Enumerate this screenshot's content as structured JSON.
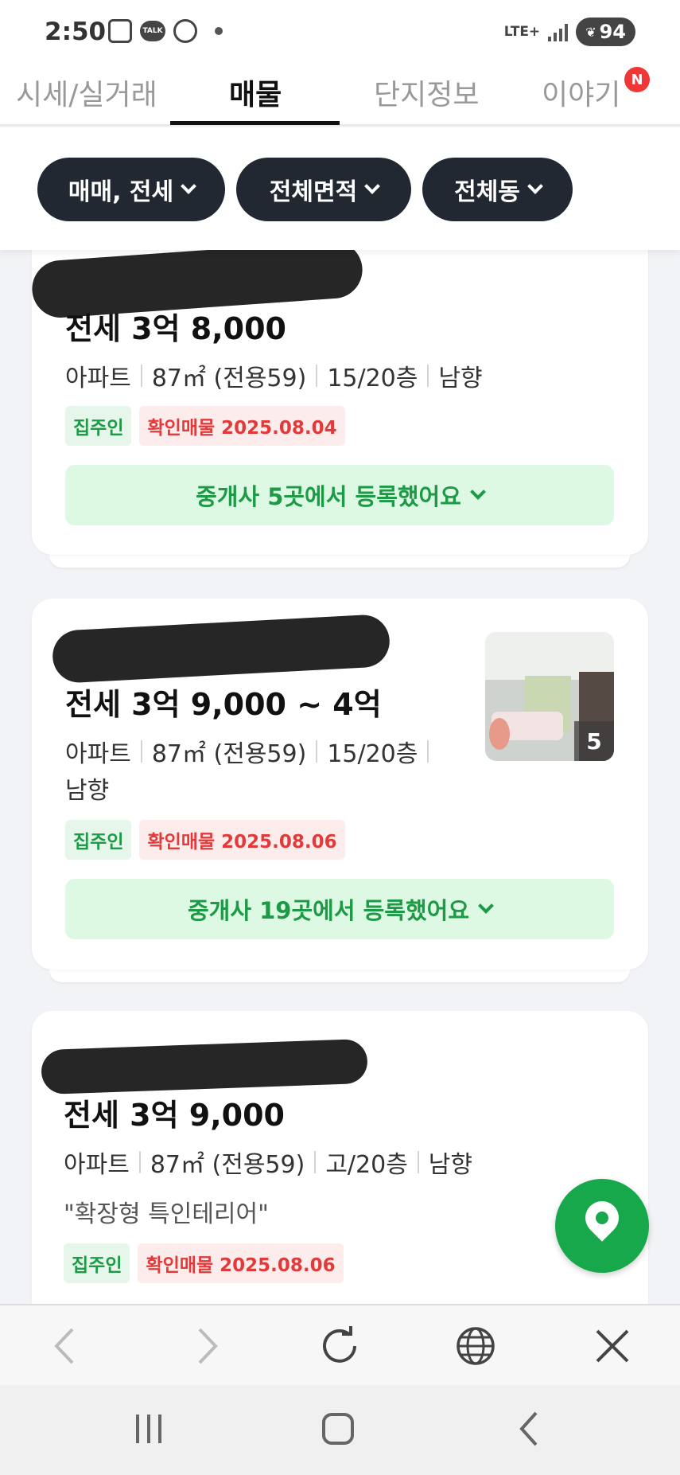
{
  "status_bar": {
    "time": "2:50",
    "talk_label": "TALK",
    "network": "LTE+",
    "battery": "94"
  },
  "tabs": [
    {
      "label": "시세/실거래",
      "active": false
    },
    {
      "label": "매물",
      "active": true
    },
    {
      "label": "단지정보",
      "active": false
    },
    {
      "label": "이야기",
      "active": false,
      "badge": "N"
    }
  ],
  "filters": [
    {
      "label": "매매, 전세"
    },
    {
      "label": "전체면적"
    },
    {
      "label": "전체동"
    }
  ],
  "listings": [
    {
      "price": "전세 3억 8,000",
      "type": "아파트",
      "area": "87㎡ (전용59)",
      "floor": "15/20층",
      "direction": "남향",
      "tag_owner": "집주인",
      "tag_confirm": "확인매물 2025.08.04",
      "broker_text": "중개사 5곳에서 등록했어요"
    },
    {
      "price": "전세 3억 9,000 ~ 4억",
      "type": "아파트",
      "area": "87㎡ (전용59)",
      "floor": "15/20층",
      "direction": "남향",
      "tag_owner": "집주인",
      "tag_confirm": "확인매물 2025.08.06",
      "broker_text": "중개사 19곳에서 등록했어요",
      "photo_count": "5"
    },
    {
      "price": "전세 3억 9,000",
      "type": "아파트",
      "area": "87㎡ (전용59)",
      "floor": "고/20층",
      "direction": "남향",
      "description": "\"확장형 특인테리어\"",
      "tag_owner": "집주인",
      "tag_confirm": "확인매물 2025.08.06"
    }
  ],
  "colors": {
    "accent_green": "#17a84b",
    "pill_dark": "#222832",
    "confirm_red": "#e23a3a"
  },
  "icons": {
    "fab": "map-pin-icon",
    "browser": [
      "back-arrow-icon",
      "forward-arrow-icon",
      "refresh-icon",
      "globe-icon",
      "close-icon"
    ],
    "system_nav": [
      "recents-icon",
      "home-icon",
      "back-icon"
    ]
  }
}
